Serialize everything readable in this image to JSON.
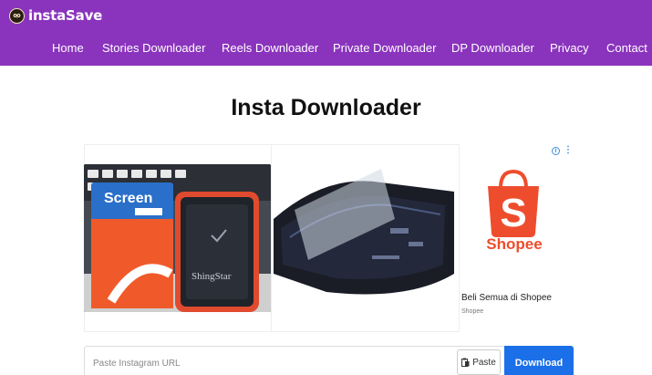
{
  "header": {
    "brand": "instaSave",
    "nav": [
      "Home",
      "Stories Downloader",
      "Reels Downloader",
      "Private Downloader",
      "DP Downloader",
      "Privacy",
      "Contact"
    ]
  },
  "main": {
    "title": "Insta Downloader"
  },
  "ad": {
    "brand_word": "Shopee",
    "headline": "Beli Semua di Shopee",
    "source": "Shopee",
    "product_box_text": "Screen",
    "product_phone_text": "ShingStar"
  },
  "search": {
    "placeholder": "Paste Instagram URL",
    "value": "",
    "paste_label": "Paste",
    "download_label": "Download"
  },
  "colors": {
    "header_bg": "#8a34bd",
    "download_bg": "#1b6fe8",
    "shopee": "#ee4d2d"
  }
}
